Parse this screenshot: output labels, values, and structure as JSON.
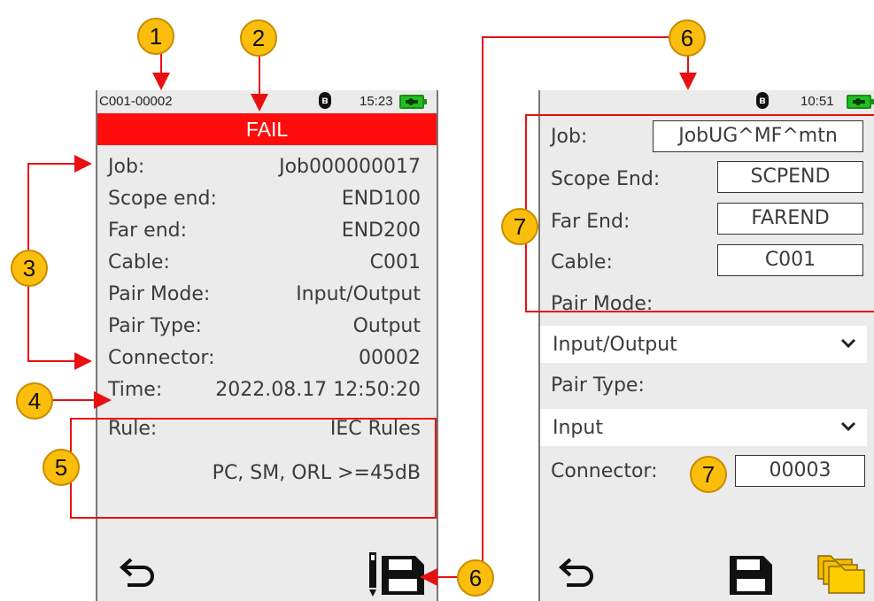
{
  "left_screen": {
    "status": {
      "id": "C001-00002",
      "bluetooth_icon": "bluetooth-icon",
      "time": "15:23",
      "battery_icon": "battery-charging-icon"
    },
    "banner": "FAIL",
    "rows": [
      {
        "label": "Job:",
        "value": "Job000000017"
      },
      {
        "label": "Scope end:",
        "value": "END100"
      },
      {
        "label": "Far end:",
        "value": "END200"
      },
      {
        "label": "Cable:",
        "value": "C001"
      },
      {
        "label": "Pair Mode:",
        "value": "Input/Output"
      },
      {
        "label": "Pair Type:",
        "value": "Output"
      },
      {
        "label": "Connector:",
        "value": "00002"
      },
      {
        "label": "Time:",
        "value": "2022.08.17 12:50:20"
      },
      {
        "label": "Rule:",
        "value": "IEC Rules"
      }
    ],
    "rule_detail": "PC, SM, ORL >=45dB",
    "back_icon": "back-arrow-icon",
    "save_icon": "edit-save-icon"
  },
  "right_screen": {
    "status": {
      "bluetooth_icon": "bluetooth-icon",
      "time": "10:51",
      "battery_icon": "battery-charging-icon"
    },
    "job_label": "Job:",
    "job_value": "JobUG^MF^mtn",
    "scope_label": "Scope End:",
    "scope_value": "SCPEND",
    "far_label": "Far End:",
    "far_value": "FAREND",
    "cable_label": "Cable:",
    "cable_value": "C001",
    "pair_mode_label": "Pair Mode:",
    "pair_mode_value": "Input/Output",
    "pair_type_label": "Pair Type:",
    "pair_type_value": "Input",
    "connector_label": "Connector:",
    "connector_value": "00003",
    "back_icon": "back-arrow-icon",
    "save_icon": "save-icon",
    "folder_icon": "folder-icon"
  },
  "callouts": [
    "1",
    "2",
    "3",
    "4",
    "5",
    "6",
    "6",
    "7",
    "7"
  ],
  "colors": {
    "fail": "#ff0d0d",
    "callout": "#fbbe0d",
    "leader": "#e81010",
    "screen": "#ebebeb"
  }
}
